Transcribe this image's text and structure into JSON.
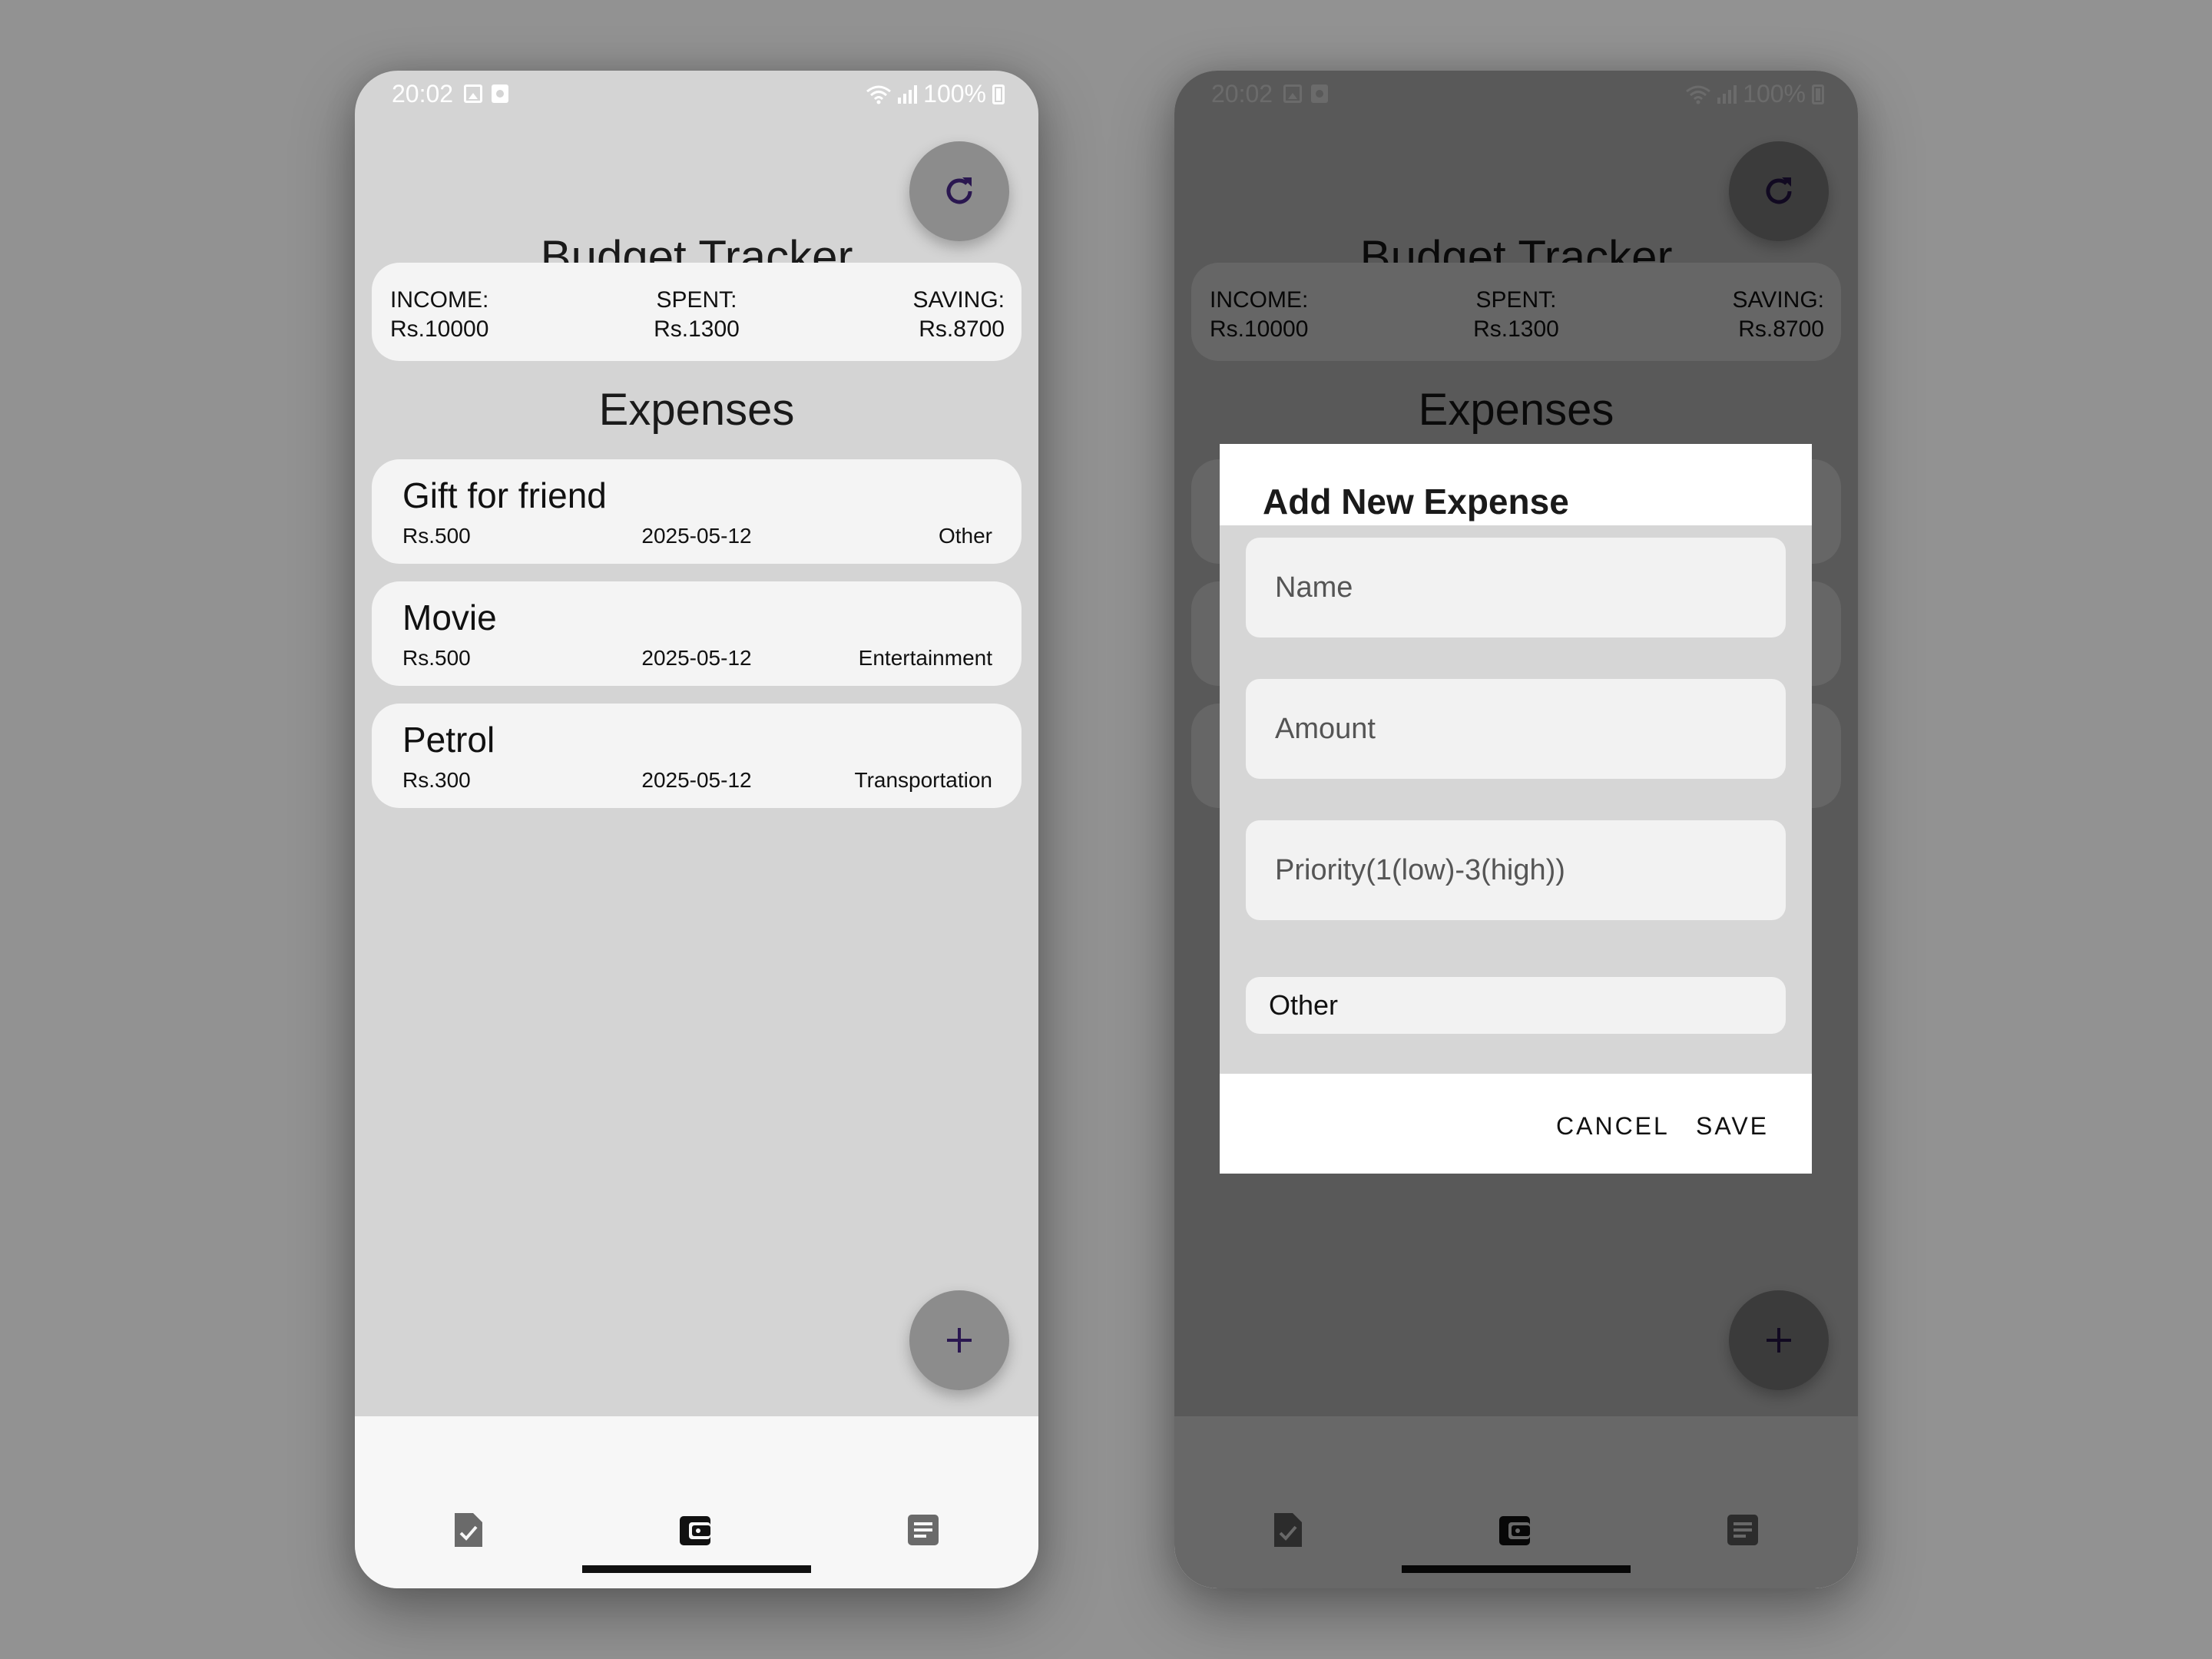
{
  "status_bar": {
    "time": "20:02",
    "battery": "100%"
  },
  "app": {
    "title": "Budget Tracker"
  },
  "summary": {
    "income_label": "INCOME:",
    "income_value": "Rs.10000",
    "spent_label": "SPENT:",
    "spent_value": "Rs.1300",
    "saving_label": "SAVING:",
    "saving_value": "Rs.8700"
  },
  "section_title": "Expenses",
  "expenses": [
    {
      "name": "Gift for friend",
      "amount": "Rs.500",
      "date": "2025-05-12",
      "category": "Other"
    },
    {
      "name": "Movie",
      "amount": "Rs.500",
      "date": "2025-05-12",
      "category": "Entertainment"
    },
    {
      "name": "Petrol",
      "amount": "Rs.300",
      "date": "2025-05-12",
      "category": "Transportation"
    }
  ],
  "fab": {
    "refresh_icon": "refresh-icon",
    "add_icon": "plus-icon"
  },
  "bottom_nav": {
    "items": [
      "task-icon",
      "wallet-icon",
      "list-icon"
    ],
    "selected": "wallet-icon"
  },
  "dialog": {
    "title": "Add New Expense",
    "name_placeholder": "Name",
    "amount_placeholder": "Amount",
    "priority_placeholder": "Priority(1(low)-3(high))",
    "category_value": "Other",
    "cancel_label": "CANCEL",
    "save_label": "SAVE"
  },
  "colors": {
    "accent": "#2a1750",
    "background": "#929292",
    "card": "#f4f4f4"
  }
}
